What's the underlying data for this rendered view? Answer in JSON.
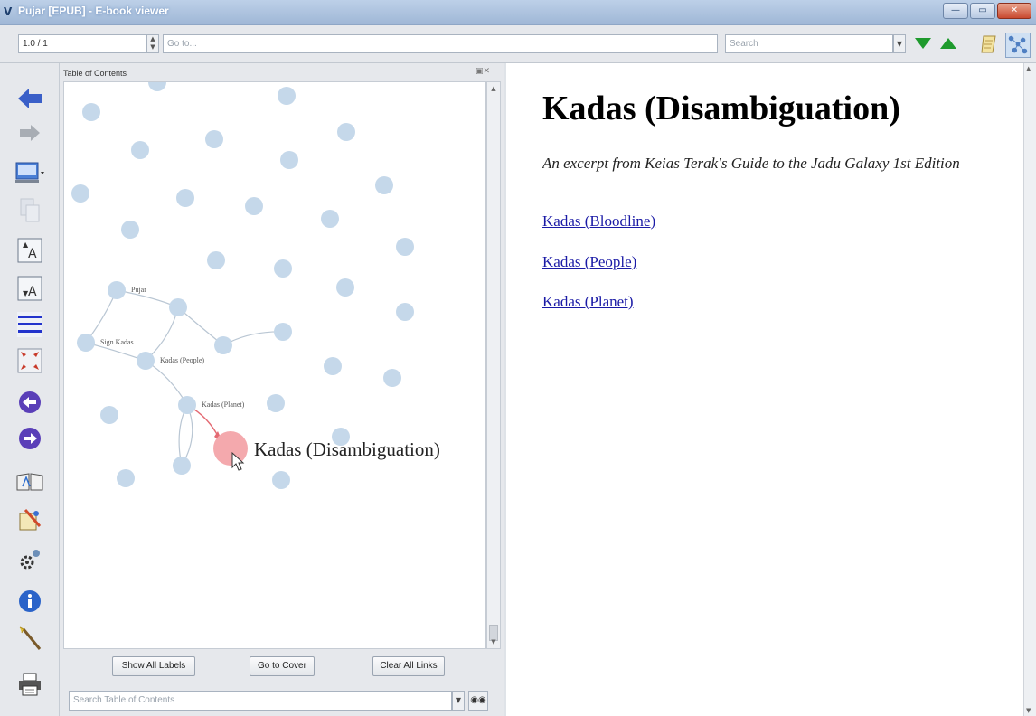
{
  "window": {
    "title": "Pujar [EPUB] - E-book viewer",
    "buttons": {
      "minimize": "—",
      "maximize": "▭",
      "close": "✕"
    }
  },
  "toolbar": {
    "page_value": "1.0 / 1",
    "goto_placeholder": "Go to...",
    "search_placeholder": "Search",
    "icons": [
      "spinner-icon",
      "dropdown-icon",
      "find-next-icon",
      "find-previous-icon",
      "bookmark-note-icon",
      "graph-view-icon"
    ]
  },
  "sidebar": {
    "icons": [
      "back-arrow-icon",
      "forward-arrow-icon",
      "monitor-icon",
      "copy-icon",
      "font-larger-icon",
      "font-smaller-icon",
      "toc-lines-icon",
      "fullscreen-icon",
      "previous-page-icon",
      "next-page-icon",
      "book-icon",
      "preferences-icon",
      "settings-gear-icon",
      "info-icon",
      "magic-wand-icon",
      "print-icon"
    ],
    "font_larger_glyph": "A",
    "font_smaller_glyph": "A",
    "colors": {
      "nav_blue": "#3a5fc8",
      "circle_purple": "#5a3fb8",
      "toc_blue": "#2233cc"
    }
  },
  "toc": {
    "title": "Table of Contents",
    "panel_controls": "▣✕",
    "buttons": {
      "show_labels": "Show All Labels",
      "go_cover": "Go to Cover",
      "clear_links": "Clear All Links"
    },
    "search_placeholder": "Search Table of Contents",
    "node_labels": {
      "pujar": "Pujar",
      "sign_kadas": "Sign Kadas",
      "kadas_people": "Kadas (People)",
      "kadas_planet": "Kadas (Planet)",
      "current": "Kadas (Disambiguation)"
    },
    "colors": {
      "node": "#c5d8ea",
      "active_node": "#f4a9ad",
      "edge": "#b9c6d3",
      "active_edge": "#e46a73"
    }
  },
  "content": {
    "heading": "Kadas (Disambiguation)",
    "subtitle": "An excerpt from Keias Terak's Guide to the Jadu Galaxy 1st Edition",
    "links": [
      "Kadas (Bloodline)",
      "Kadas (People)",
      "Kadas (Planet)"
    ],
    "link_color": "#1a1aa6"
  }
}
